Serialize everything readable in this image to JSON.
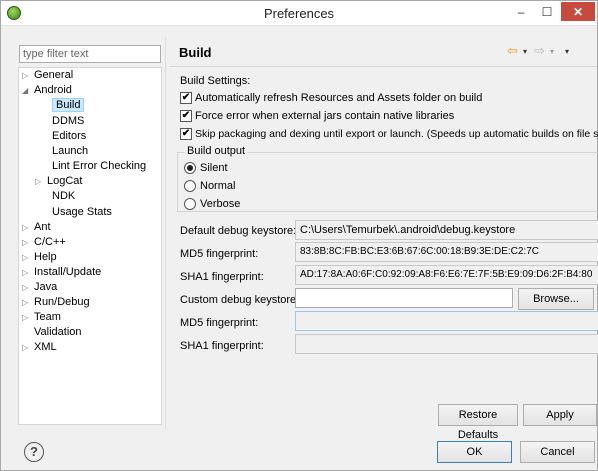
{
  "window": {
    "title": "Preferences",
    "min_glyph": "–",
    "max_glyph": "☐",
    "close_glyph": "✕"
  },
  "filter": {
    "placeholder": "type filter text"
  },
  "tree": [
    {
      "label": "General",
      "arrow": "▷",
      "selected": false
    },
    {
      "label": "Android",
      "arrow": "◢",
      "selected": false
    },
    {
      "label": "Build",
      "arrow": "",
      "selected": true
    },
    {
      "label": "DDMS",
      "arrow": "",
      "selected": false
    },
    {
      "label": "Editors",
      "arrow": "",
      "selected": false
    },
    {
      "label": "Launch",
      "arrow": "",
      "selected": false
    },
    {
      "label": "Lint Error Checking",
      "arrow": "",
      "selected": false
    },
    {
      "label": "LogCat",
      "arrow": "▷",
      "selected": false
    },
    {
      "label": "NDK",
      "arrow": "",
      "selected": false
    },
    {
      "label": "Usage Stats",
      "arrow": "",
      "selected": false
    },
    {
      "label": "Ant",
      "arrow": "▷",
      "selected": false
    },
    {
      "label": "C/C++",
      "arrow": "▷",
      "selected": false
    },
    {
      "label": "Help",
      "arrow": "▷",
      "selected": false
    },
    {
      "label": "Install/Update",
      "arrow": "▷",
      "selected": false
    },
    {
      "label": "Java",
      "arrow": "▷",
      "selected": false
    },
    {
      "label": "Run/Debug",
      "arrow": "▷",
      "selected": false
    },
    {
      "label": "Team",
      "arrow": "▷",
      "selected": false
    },
    {
      "label": "Validation",
      "arrow": "",
      "selected": false
    },
    {
      "label": "XML",
      "arrow": "▷",
      "selected": false
    }
  ],
  "page": {
    "title": "Build",
    "history": {
      "back": "⇦",
      "forward": "⇨",
      "dropdown": "▾",
      "menu": "▾"
    },
    "build_settings_label": "Build Settings:",
    "options": [
      {
        "label": "Automatically refresh Resources and Assets folder on build",
        "checked": true
      },
      {
        "label": "Force error when external jars contain native libraries",
        "checked": true
      },
      {
        "label": "Skip packaging and dexing until export or launch. (Speeds up automatic builds on file save)",
        "checked": true
      }
    ],
    "build_output": {
      "label": "Build output",
      "choices": [
        {
          "label": "Silent",
          "selected": true
        },
        {
          "label": "Normal",
          "selected": false
        },
        {
          "label": "Verbose",
          "selected": false
        }
      ]
    },
    "default_keystore": {
      "label": "Default debug keystore:",
      "value": "C:\\Users\\Temurbek\\.android\\debug.keystore"
    },
    "md5_1": {
      "label": "MD5 fingerprint:",
      "value": "83:8B:8C:FB:BC:E3:6B:67:6C:00:18:B9:3E:DE:C2:7C"
    },
    "sha1_1": {
      "label": "SHA1 fingerprint:",
      "value": "AD:17:8A:A0:6F:C0:92:09:A8:F6:E6:7E:7F:5B:E9:09:D6:2F:B4:80"
    },
    "custom_keystore": {
      "label": "Custom debug keystore:",
      "value": ""
    },
    "browse": {
      "label": "Browse..."
    },
    "md5_2": {
      "label": "MD5 fingerprint:",
      "value": ""
    },
    "sha1_2": {
      "label": "SHA1 fingerprint:",
      "value": ""
    },
    "restore_defaults": {
      "label": "Restore Defaults"
    },
    "apply": {
      "label": "Apply"
    }
  },
  "footer": {
    "help": "?",
    "ok": "OK",
    "cancel": "Cancel"
  },
  "colors": {
    "close": "#c74a3e",
    "selection": "#cce8ff",
    "back_arrow": "#e8a317"
  }
}
